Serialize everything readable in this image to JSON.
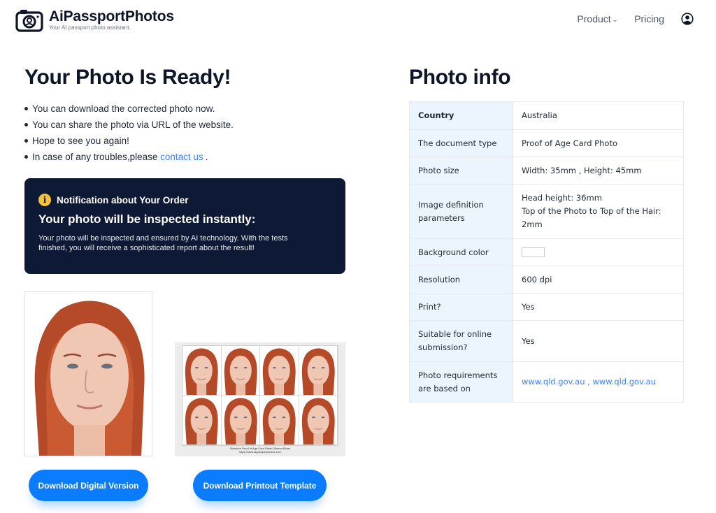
{
  "header": {
    "brand": "AiPassportPhotos",
    "tagline": "Your AI passport photo assistant.",
    "nav": {
      "product": "Product",
      "pricing": "Pricing"
    }
  },
  "ready": {
    "title": "Your Photo Is Ready!",
    "bullets": [
      "You can download the corrected photo now.",
      "You can share the photo via URL of the website.",
      "Hope to see you again!",
      "In case of any troubles,please"
    ],
    "contact_link": "contact us",
    "contact_suffix": "."
  },
  "notice": {
    "heading": "Notification about Your Order",
    "title": "Your photo will be inspected instantly:",
    "body": "Your photo will be inspected and ensured by AI technology. With the tests finished, you will receive a sophisticated report about the result!"
  },
  "sheet": {
    "caption_line1": "Standard Proof of Age Card Photo,35mm×45mm",
    "caption_line2": "https://www.aipassportphotos.com"
  },
  "buttons": {
    "digital": "Download Digital Version",
    "printout": "Download Printout Template"
  },
  "info": {
    "title": "Photo info",
    "rows": [
      {
        "label": "Country",
        "value": "Australia"
      },
      {
        "label": "The document type",
        "value": "Proof of Age Card Photo"
      },
      {
        "label": "Photo size",
        "value": "Width: 35mm , Height: 45mm"
      },
      {
        "label": "Image definition parameters",
        "value_line1": "Head height: 36mm",
        "value_line2": "Top of the Photo to Top of the Hair: 2mm"
      },
      {
        "label": "Background color",
        "swatch": "#ffffff"
      },
      {
        "label": "Resolution",
        "value": "600 dpi"
      },
      {
        "label": "Print?",
        "value": "Yes"
      },
      {
        "label": "Suitable for online submission?",
        "value": "Yes"
      },
      {
        "label": "Photo requirements are based on",
        "link1": "www.qld.gov.au",
        "separator": " , ",
        "link2": "www.qld.gov.au"
      }
    ]
  },
  "colors": {
    "accent": "#0a7cff",
    "notice_bg": "#0e1936",
    "info_icon": "#f5c33b",
    "link": "#3b82f6",
    "table_key_bg": "#eaf5fd"
  }
}
